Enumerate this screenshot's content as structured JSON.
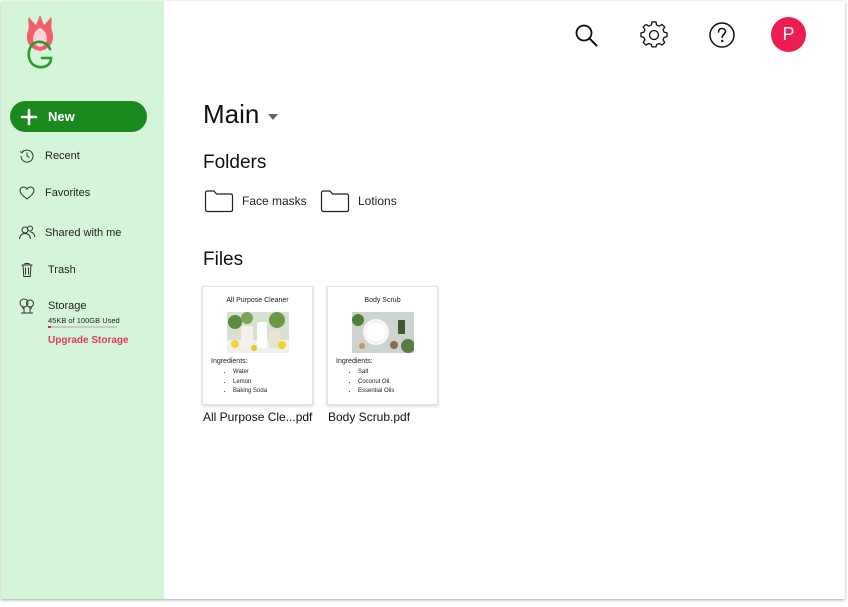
{
  "sidebar": {
    "new_label": "New",
    "items": [
      {
        "label": "Recent",
        "icon": "history-icon"
      },
      {
        "label": "Favorites",
        "icon": "heart-icon"
      },
      {
        "label": "Shared with me",
        "icon": "people-icon"
      },
      {
        "label": "Trash",
        "icon": "trash-icon"
      },
      {
        "label": "Storage",
        "icon": "tree-icon"
      }
    ],
    "storage": {
      "used_text": "45KB of 100GB Used",
      "used_fraction": 4.5e-06,
      "upgrade_label": "Upgrade Storage"
    }
  },
  "header": {
    "avatar_letter": "P",
    "icons": [
      "search-icon",
      "gear-icon",
      "help-icon"
    ]
  },
  "main": {
    "title": "Main",
    "folders_heading": "Folders",
    "folders": [
      {
        "name": "Face masks"
      },
      {
        "name": "Lotions"
      }
    ],
    "files_heading": "Files",
    "files": [
      {
        "preview_title": "All Purpose Cleaner",
        "ingredients_label": "Ingredients:",
        "ingredients": [
          "Water",
          "Lemon",
          "Baking Soda"
        ],
        "filename": "All Purpose Cle...pdf"
      },
      {
        "preview_title": "Body Scrub",
        "ingredients_label": "Ingredients:",
        "ingredients": [
          "Salt",
          "Coconut Oil",
          "Essential Oils"
        ],
        "filename": "Body Scrub.pdf"
      }
    ]
  },
  "colors": {
    "sidebar_bg": "#d4f5d8",
    "new_button": "#1b8a1e",
    "avatar": "#ee1d4f",
    "upgrade": "#e23a57"
  }
}
